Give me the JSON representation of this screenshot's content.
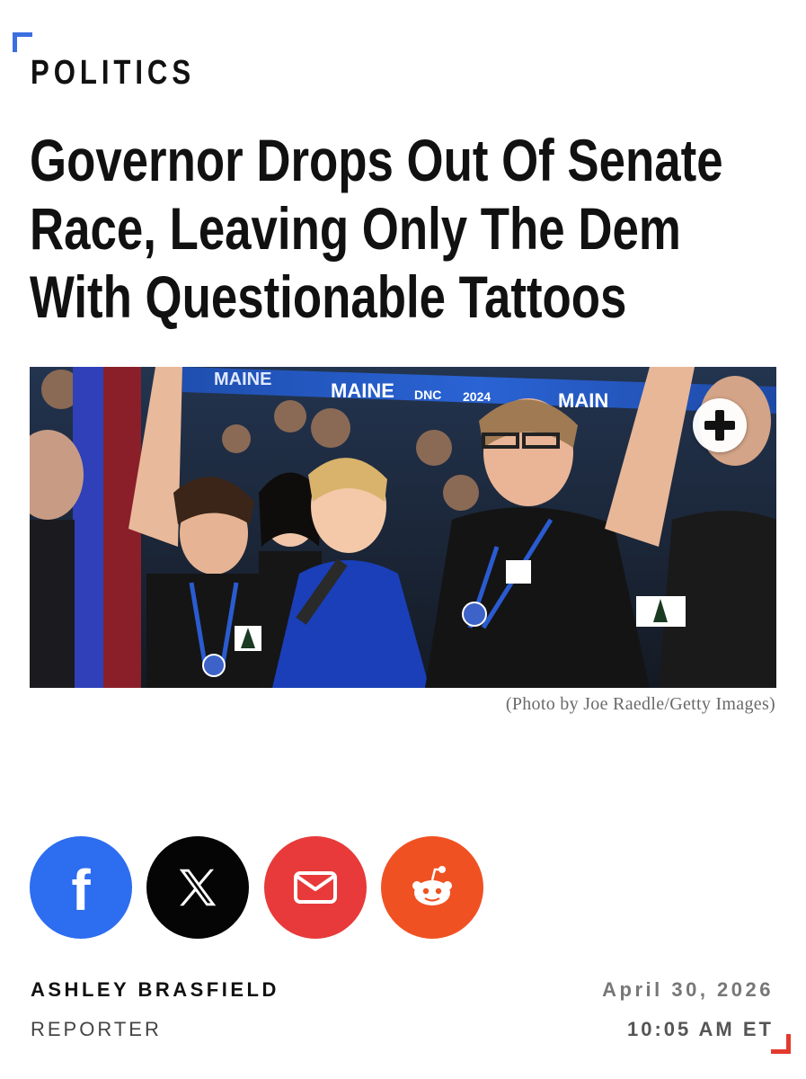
{
  "article": {
    "section": "POLITICS",
    "headline": "Governor Drops Out Of Senate Race, Leaving Only The Dem With Questionable Tattoos",
    "photo_caption": "(Photo by Joe Raedle/Getty Images)",
    "banner_texts": [
      "MAINE",
      "MAINE",
      "DNC",
      "2024",
      "MAIN"
    ]
  },
  "share": {
    "buttons": [
      {
        "icon": "facebook-icon",
        "color": "#2d6df0"
      },
      {
        "icon": "x-icon",
        "color": "#050505"
      },
      {
        "icon": "mail-icon",
        "color": "#e83a3a"
      },
      {
        "icon": "reddit-icon",
        "color": "#f05122"
      }
    ]
  },
  "byline": {
    "author": "ASHLEY BRASFIELD",
    "role": "REPORTER",
    "date": "April 30, 2026",
    "time": "10:05 AM ET"
  },
  "colors": {
    "accent_blue": "#3b6fe0",
    "accent_red": "#e23b2e"
  }
}
